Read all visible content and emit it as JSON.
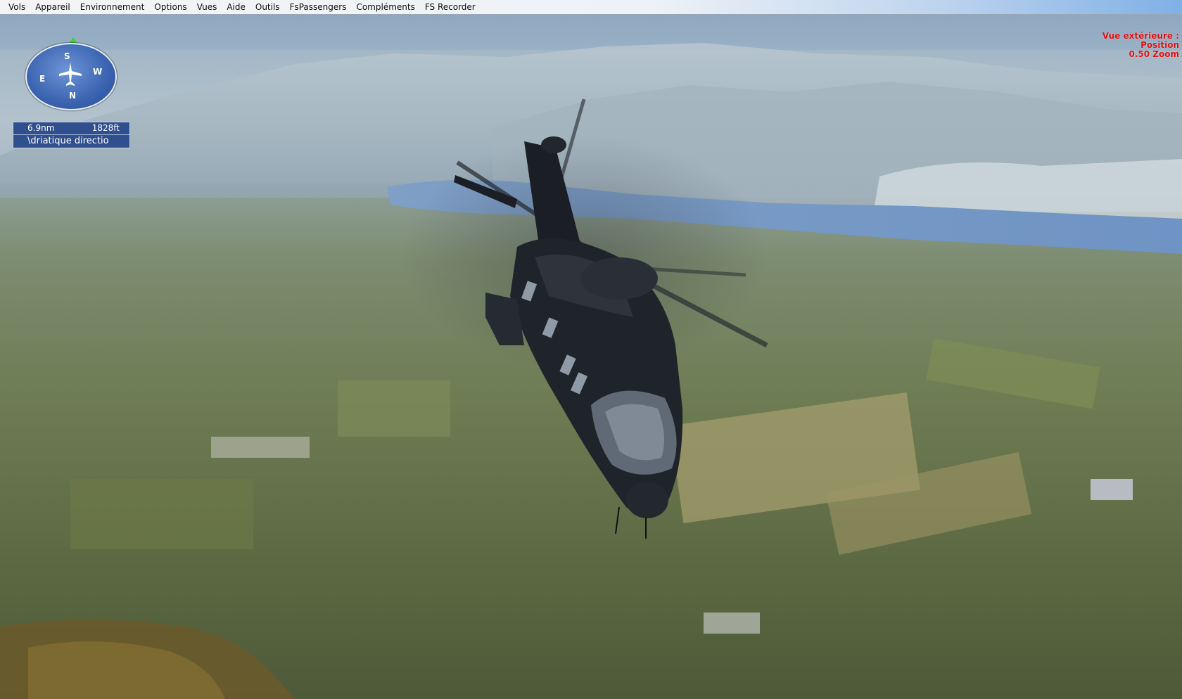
{
  "menu": {
    "items": [
      "Vols",
      "Appareil",
      "Environnement",
      "Options",
      "Vues",
      "Aide",
      "Outils",
      "FsPassengers",
      "Compléments",
      "FS Recorder"
    ]
  },
  "hud": {
    "compass": {
      "letters": {
        "north": "N",
        "south": "S",
        "east": "E",
        "west": "W"
      }
    },
    "distance": "6.9nm",
    "altitude": "1828ft",
    "destination": "\\driatique directio"
  },
  "view_label": {
    "line1": "Vue extérieure :",
    "line2": "Position",
    "line3": "0.50 Zoom"
  },
  "colors": {
    "hud_panel": "#2f4f8e",
    "compass": "#3a63b0",
    "view_label": "#e11010",
    "helicopter_body": "#1e2228"
  }
}
